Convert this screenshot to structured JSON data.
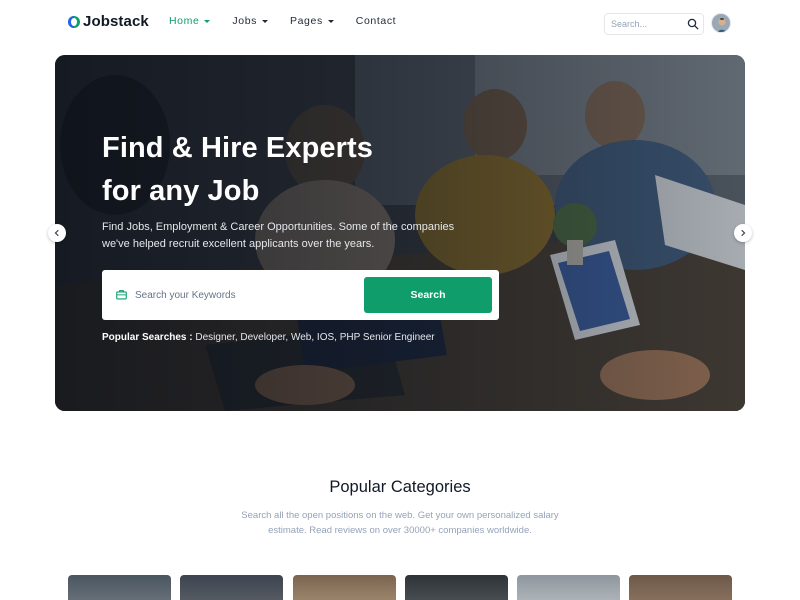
{
  "brand": {
    "name": "Jobstack"
  },
  "nav": {
    "items": [
      {
        "label": "Home",
        "has_dropdown": true,
        "active": true
      },
      {
        "label": "Jobs",
        "has_dropdown": true,
        "active": false
      },
      {
        "label": "Pages",
        "has_dropdown": true,
        "active": false
      },
      {
        "label": "Contact",
        "has_dropdown": false,
        "active": false
      }
    ]
  },
  "header_search": {
    "placeholder": "Search...",
    "icon": "search-icon"
  },
  "user": {
    "avatar_icon": "avatar"
  },
  "hero": {
    "title_line1": "Find & Hire Experts",
    "title_line2": "for any Job",
    "description": "Find Jobs, Employment & Career Opportunities. Some of the companies we've helped recruit excellent applicants over the years.",
    "search": {
      "placeholder": "Search your Keywords",
      "icon": "briefcase-icon",
      "button_label": "Search"
    },
    "popular_label": "Popular Searches :",
    "popular_terms": "Designer, Developer, Web, IOS, PHP Senior Engineer",
    "prev_icon": "chevron-left-icon",
    "next_icon": "chevron-right-icon"
  },
  "categories": {
    "title": "Popular Categories",
    "subtitle": "Search all the open positions on the web. Get your own personalized salary estimate. Read reviews on over 30000+ companies worldwide."
  },
  "colors": {
    "accent": "#0f9d6c",
    "text_dark": "#111827",
    "text_muted": "#94a3b8"
  }
}
